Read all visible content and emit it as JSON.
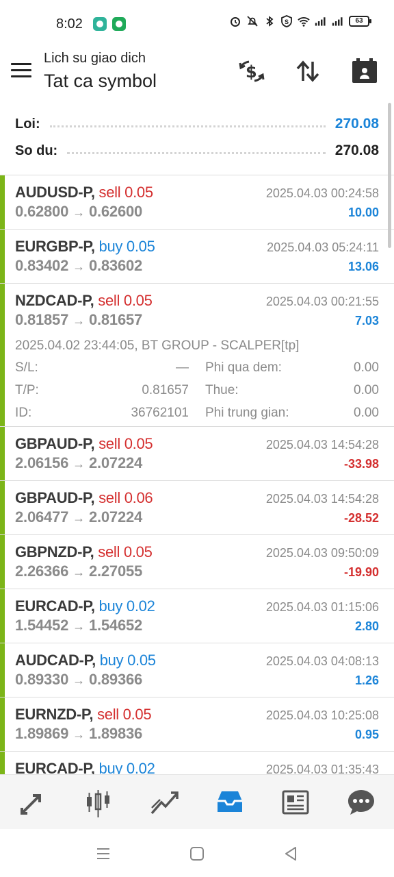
{
  "status_bar": {
    "time": "8:02",
    "battery": "63"
  },
  "header": {
    "subtitle": "Lich su giao dich",
    "title": "Tat ca symbol"
  },
  "summary": {
    "profit_label": "Loi:",
    "profit_value": "270.08",
    "balance_label": "So du:",
    "balance_value": "270.08"
  },
  "deals": [
    {
      "symbol": "AUDUSD-P,",
      "side": "sell 0.05",
      "open": "0.62800",
      "close": "0.62600",
      "time": "2025.04.03 00:24:58",
      "profit": "10.00"
    },
    {
      "symbol": "EURGBP-P,",
      "side": "buy 0.05",
      "open": "0.83402",
      "close": "0.83602",
      "time": "2025.04.03 05:24:11",
      "profit": "13.06"
    },
    {
      "symbol": "NZDCAD-P,",
      "side": "sell 0.05",
      "open": "0.81857",
      "close": "0.81657",
      "time": "2025.04.03 00:21:55",
      "profit": "7.03",
      "details": {
        "comment": "2025.04.02 23:44:05, BT GROUP - SCALPER[tp]",
        "sl_label": "S/L:",
        "sl_value": "—",
        "tp_label": "T/P:",
        "tp_value": "0.81657",
        "id_label": "ID:",
        "id_value": "36762101",
        "swap_label": "Phi qua dem:",
        "swap_value": "0.00",
        "tax_label": "Thue:",
        "tax_value": "0.00",
        "commission_label": "Phi trung gian:",
        "commission_value": "0.00"
      }
    },
    {
      "symbol": "GBPAUD-P,",
      "side": "sell 0.05",
      "open": "2.06156",
      "close": "2.07224",
      "time": "2025.04.03 14:54:28",
      "profit": "-33.98"
    },
    {
      "symbol": "GBPAUD-P,",
      "side": "sell 0.06",
      "open": "2.06477",
      "close": "2.07224",
      "time": "2025.04.03 14:54:28",
      "profit": "-28.52"
    },
    {
      "symbol": "GBPNZD-P,",
      "side": "sell 0.05",
      "open": "2.26366",
      "close": "2.27055",
      "time": "2025.04.03 09:50:09",
      "profit": "-19.90"
    },
    {
      "symbol": "EURCAD-P,",
      "side": "buy 0.02",
      "open": "1.54452",
      "close": "1.54652",
      "time": "2025.04.03 01:15:06",
      "profit": "2.80"
    },
    {
      "symbol": "AUDCAD-P,",
      "side": "buy 0.05",
      "open": "0.89330",
      "close": "0.89366",
      "time": "2025.04.03 04:08:13",
      "profit": "1.26"
    },
    {
      "symbol": "EURNZD-P,",
      "side": "sell 0.05",
      "open": "1.89869",
      "close": "1.89836",
      "time": "2025.04.03 10:25:08",
      "profit": "0.95"
    },
    {
      "symbol": "EURCAD-P,",
      "side": "buy 0.02",
      "open": "",
      "close": "",
      "time": "2025.04.03 01:35:43",
      "profit": ""
    }
  ],
  "colors": {
    "sell": "#d42f2f",
    "buy": "#1b84d8",
    "accent": "#1b84d8",
    "deal_bar": "#7cb518"
  },
  "bottom_nav": [
    {
      "name": "quotes",
      "icon": "quotes-arrows-icon"
    },
    {
      "name": "chart",
      "icon": "candlestick-chart-icon"
    },
    {
      "name": "trade",
      "icon": "trend-line-icon"
    },
    {
      "name": "history",
      "icon": "inbox-history-icon",
      "active": true
    },
    {
      "name": "news",
      "icon": "newspaper-icon"
    },
    {
      "name": "chat",
      "icon": "chat-bubble-icon"
    }
  ]
}
